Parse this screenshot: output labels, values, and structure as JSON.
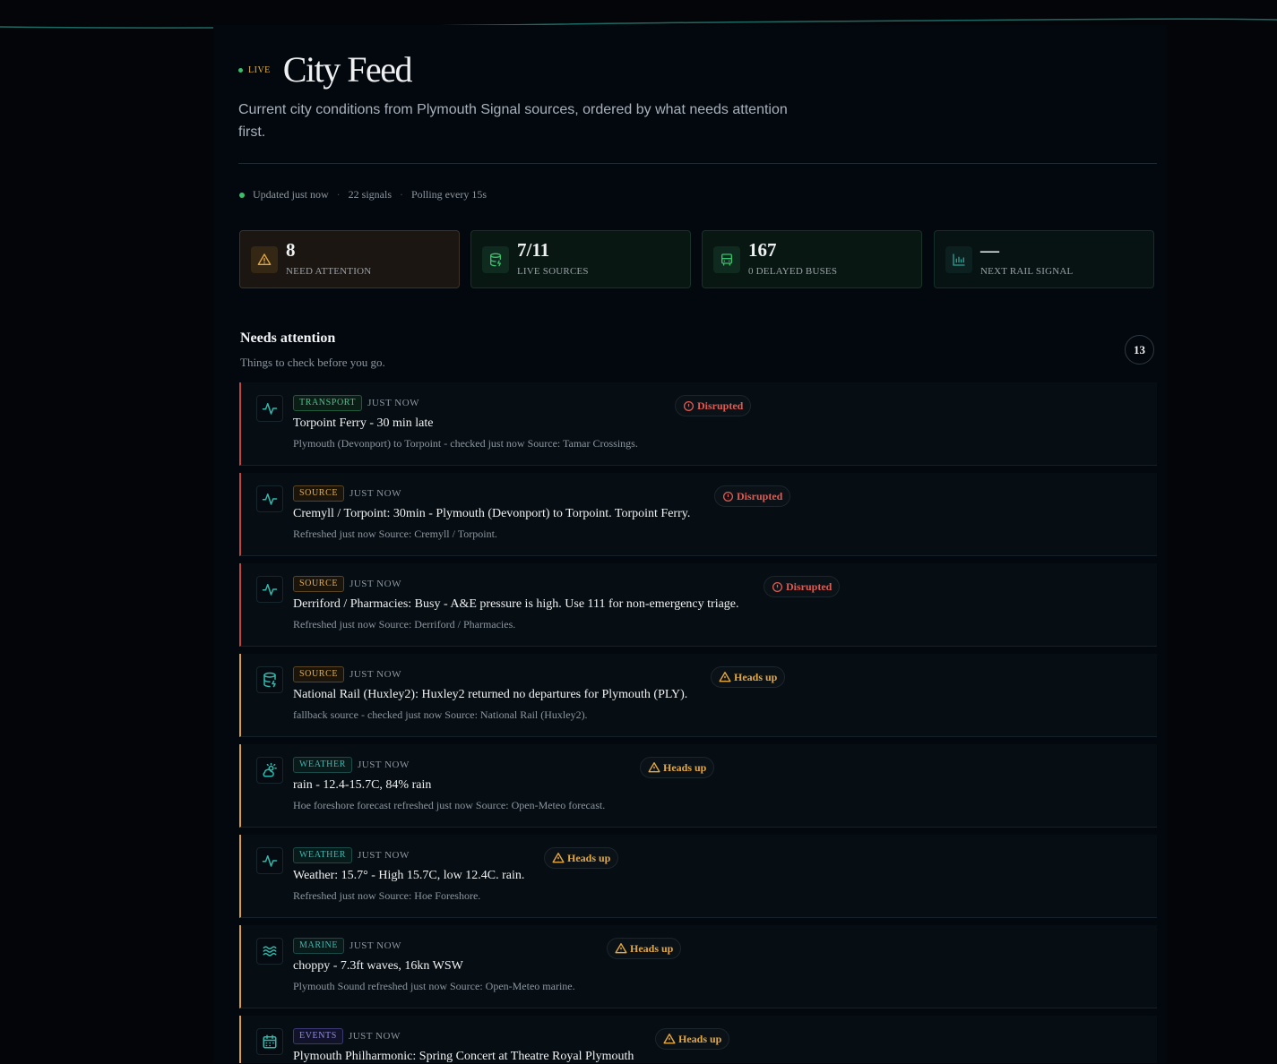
{
  "header": {
    "live_label": "LIVE",
    "title": "City Feed",
    "subtitle": "Current city conditions from Plymouth Signal sources, ordered by what needs attention first."
  },
  "status": {
    "updated": "Updated just now",
    "signals": "22 signals",
    "polling": "Polling every 15s"
  },
  "stats": [
    {
      "value": "8",
      "label": "NEED ATTENTION",
      "icon": "warning-icon"
    },
    {
      "value": "7/11",
      "label": "LIVE SOURCES",
      "icon": "database-icon"
    },
    {
      "value": "167",
      "label": "0 DELAYED BUSES",
      "icon": "bus-icon"
    },
    {
      "value": "—",
      "label": "NEXT RAIL SIGNAL",
      "icon": "bar-chart-icon"
    }
  ],
  "section": {
    "title": "Needs attention",
    "subtitle": "Things to check before you go.",
    "count": "13"
  },
  "cards": [
    {
      "tag": "TRANSPORT",
      "tag_kind": "transport",
      "time": "JUST NOW",
      "headline": "Torpoint Ferry - 30 min late",
      "detail": "Plymouth (Devonport) to Torpoint - checked just now Source: Tamar Crossings.",
      "badge": "Disrupted",
      "severity": "disrupted",
      "icon": "pulse-icon"
    },
    {
      "tag": "SOURCE",
      "tag_kind": "source",
      "time": "JUST NOW",
      "headline": "Cremyll / Torpoint: 30min - Plymouth (Devonport) to Torpoint. Torpoint Ferry.",
      "detail": "Refreshed just now Source: Cremyll / Torpoint.",
      "badge": "Disrupted",
      "severity": "disrupted",
      "icon": "pulse-icon"
    },
    {
      "tag": "SOURCE",
      "tag_kind": "source",
      "time": "JUST NOW",
      "headline": "Derriford / Pharmacies: Busy - A&E pressure is high. Use 111 for non-emergency triage.",
      "detail": "Refreshed just now Source: Derriford / Pharmacies.",
      "badge": "Disrupted",
      "severity": "disrupted",
      "icon": "pulse-icon"
    },
    {
      "tag": "SOURCE",
      "tag_kind": "source",
      "time": "JUST NOW",
      "headline": "National Rail (Huxley2): Huxley2 returned no departures for Plymouth (PLY).",
      "detail": "fallback source - checked just now Source: National Rail (Huxley2).",
      "badge": "Heads up",
      "severity": "heads",
      "icon": "database-icon"
    },
    {
      "tag": "WEATHER",
      "tag_kind": "weather",
      "time": "JUST NOW",
      "headline": "rain - 12.4-15.7C, 84% rain",
      "detail": "Hoe foreshore forecast refreshed just now Source: Open-Meteo forecast.",
      "badge": "Heads up",
      "severity": "heads",
      "icon": "cloud-sun-icon"
    },
    {
      "tag": "WEATHER",
      "tag_kind": "weather",
      "time": "JUST NOW",
      "headline": "Weather: 15.7° - High 15.7C, low 12.4C. rain.",
      "detail": "Refreshed just now Source: Hoe Foreshore.",
      "badge": "Heads up",
      "severity": "heads",
      "icon": "pulse-icon"
    },
    {
      "tag": "MARINE",
      "tag_kind": "marine",
      "time": "JUST NOW",
      "headline": "choppy - 7.3ft waves, 16kn WSW",
      "detail": "Plymouth Sound refreshed just now Source: Open-Meteo marine.",
      "badge": "Heads up",
      "severity": "heads",
      "icon": "waves-icon"
    },
    {
      "tag": "EVENTS",
      "tag_kind": "events",
      "time": "JUST NOW",
      "headline": "Plymouth Philharmonic: Spring Concert at Theatre Royal Plymouth",
      "detail": "",
      "badge": "Heads up",
      "severity": "heads",
      "icon": "calendar-icon"
    }
  ],
  "colors": {
    "background": "#030508",
    "disrupted": "#e05a52",
    "heads_up": "#e3a741",
    "accent_green": "#3bbf6c",
    "accent_teal": "#3cb8b0"
  }
}
